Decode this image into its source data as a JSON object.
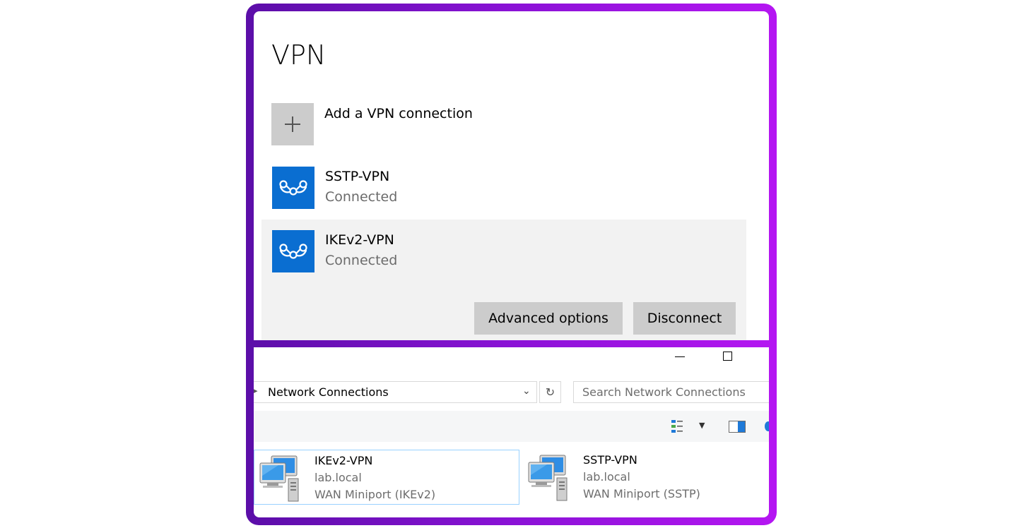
{
  "vpn_settings": {
    "title": "VPN",
    "add_connection_label": "Add a VPN connection",
    "connections": [
      {
        "name": "SSTP-VPN",
        "status": "Connected"
      },
      {
        "name": "IKEv2-VPN",
        "status": "Connected"
      }
    ],
    "selected_connection": "IKEv2-VPN",
    "buttons": {
      "advanced_options": "Advanced options",
      "disconnect": "Disconnect"
    }
  },
  "network_connections": {
    "address_bar": "Network Connections",
    "search_placeholder": "Search Network Connections",
    "connections": [
      {
        "name": "IKEv2-VPN",
        "domain": "lab.local",
        "device": "WAN Miniport (IKEv2)",
        "selected": true
      },
      {
        "name": "SSTP-VPN",
        "domain": "lab.local",
        "device": "WAN Miniport (SSTP)",
        "selected": false
      }
    ]
  },
  "colors": {
    "frame_gradient_start": "#5b0ea8",
    "frame_gradient_end": "#b516f2",
    "vpn_tile_blue": "#0a6ed1",
    "selection_border": "#99d1ff"
  },
  "icons": {
    "vpn_tile": "vpn-knot-icon",
    "add_tile": "plus-icon",
    "network_connection": "network-computers-icon"
  }
}
